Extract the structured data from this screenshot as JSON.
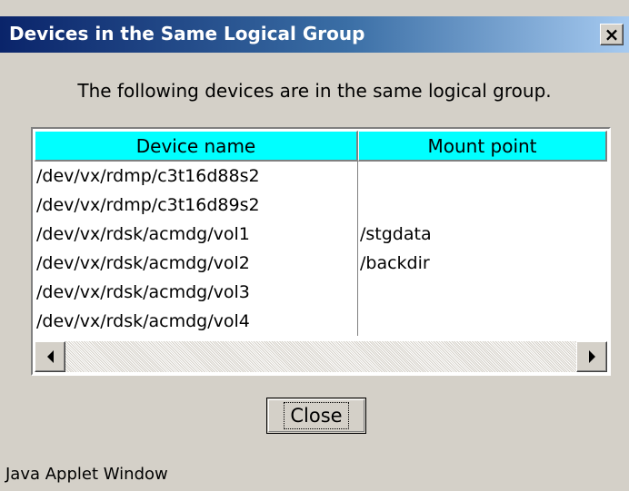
{
  "window": {
    "title": "Devices in the Same Logical Group",
    "close_glyph": "×"
  },
  "message": "The following devices are in the same logical group.",
  "table": {
    "columns": [
      "Device name",
      "Mount point"
    ],
    "rows": [
      {
        "device": "/dev/vx/rdmp/c3t16d88s2",
        "mount": ""
      },
      {
        "device": "/dev/vx/rdmp/c3t16d89s2",
        "mount": ""
      },
      {
        "device": "/dev/vx/rdsk/acmdg/vol1",
        "mount": "/stgdata"
      },
      {
        "device": "/dev/vx/rdsk/acmdg/vol2",
        "mount": "/backdir"
      },
      {
        "device": "/dev/vx/rdsk/acmdg/vol3",
        "mount": ""
      },
      {
        "device": "/dev/vx/rdsk/acmdg/vol4",
        "mount": ""
      }
    ]
  },
  "buttons": {
    "close_label": "Close"
  },
  "status_text": "Java Applet Window",
  "colors": {
    "header_bg": "#00ffff",
    "titlebar_start": "#0a246a",
    "titlebar_end": "#a6caf0",
    "dialog_bg": "#d4d0c8"
  },
  "icons": {
    "title_close": "close-icon",
    "scroll_left": "arrow-left-icon",
    "scroll_right": "arrow-right-icon"
  }
}
